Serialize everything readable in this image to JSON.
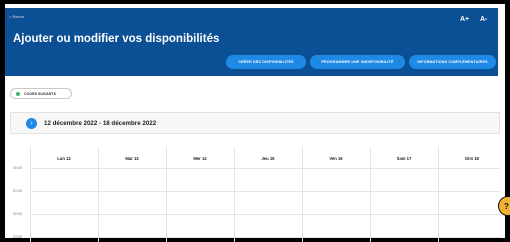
{
  "header": {
    "back_label": "< Retour",
    "title": "Ajouter ou modifier vos disponibilités",
    "font_increase": "A+",
    "font_decrease": "A-",
    "buttons": [
      "CRÉER DES DISPONIBILITÉS",
      "PROGRAMMER UNE INDISPONIBILITÉ",
      "INFORMATIONS COMPLÉMENTAIRES"
    ]
  },
  "filter": {
    "label": "COURS SUIVANTS",
    "status_color": "#3cb371"
  },
  "week": {
    "label": "12 décembre 2022 - 18 décembre 2022",
    "nav_icon": "chevron-right-icon"
  },
  "calendar": {
    "days": [
      "Lun 12",
      "Mar 13",
      "Mer 14",
      "Jeu 15",
      "Ven 16",
      "Sam 17",
      "Dim 18"
    ],
    "hours": [
      "00:00",
      "01:00",
      "02:00",
      "03:00"
    ]
  },
  "help": {
    "label": "?"
  },
  "colors": {
    "header_bg": "#0b4f94",
    "accent": "#1e8ae6",
    "help_bg": "#f2b233"
  }
}
